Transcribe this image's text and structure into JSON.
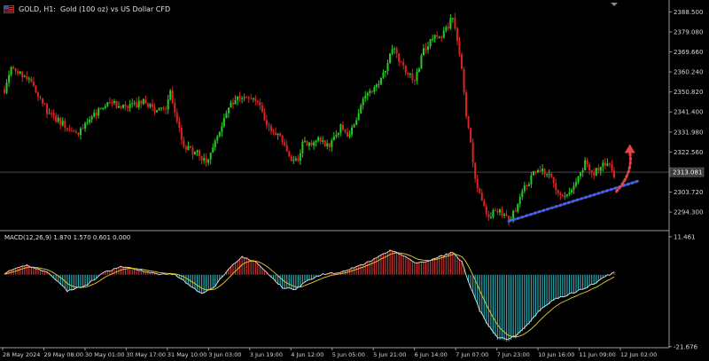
{
  "header": {
    "symbol": "GOLD, H1:",
    "description": "Gold (100 oz) vs US Dollar CFD",
    "flag_icon": "us-flag-icon"
  },
  "colors": {
    "background": "#000000",
    "bull_candle": "#22cc22",
    "bear_candle": "#dd2222",
    "grid_line": "#7a7a7a",
    "current_price_tag": "#3a3a3a",
    "support_line": "#4a5fe8",
    "arrow": "#e44444",
    "macd_positive": "#c83030",
    "macd_negative": "#2aa7b0",
    "macd_line": "#e0e0e0",
    "signal_line": "#e8d22a"
  },
  "chart_data": [
    {
      "type": "candlestick",
      "title": "GOLD, H1: Gold (100 oz) vs US Dollar CFD",
      "xlabel": "",
      "ylabel": "",
      "ylim": [
        2286.0,
        2392.0
      ],
      "y_ticks": [
        "2388.500",
        "2379.080",
        "2369.660",
        "2360.240",
        "2350.820",
        "2341.400",
        "2331.980",
        "2322.560",
        "2313.081",
        "2303.720",
        "2294.300"
      ],
      "current_price": 2313.081,
      "x_ticks": [
        "28 May 2024",
        "29 May 08:00",
        "30 May 01:00",
        "30 May 17:00",
        "31 May 10:00",
        "3 Jun 03:00",
        "3 Jun 19:00",
        "4 Jun 12:00",
        "5 Jun 05:00",
        "5 Jun 21:00",
        "6 Jun 14:00",
        "7 Jun 07:00",
        "7 Jun 23:00",
        "10 Jun 16:00",
        "11 Jun 09:00",
        "12 Jun 02:00"
      ],
      "grid": false,
      "anchors": [
        [
          0,
          2352
        ],
        [
          3,
          2362
        ],
        [
          7,
          2360
        ],
        [
          12,
          2356
        ],
        [
          20,
          2340
        ],
        [
          26,
          2336
        ],
        [
          32,
          2330
        ],
        [
          40,
          2340
        ],
        [
          48,
          2346
        ],
        [
          54,
          2343
        ],
        [
          62,
          2346
        ],
        [
          68,
          2342
        ],
        [
          72,
          2342
        ],
        [
          74,
          2350
        ],
        [
          80,
          2325
        ],
        [
          86,
          2322
        ],
        [
          90,
          2318
        ],
        [
          95,
          2330
        ],
        [
          101,
          2346
        ],
        [
          107,
          2350
        ],
        [
          112,
          2348
        ],
        [
          118,
          2334
        ],
        [
          124,
          2328
        ],
        [
          128,
          2318
        ],
        [
          131,
          2318
        ],
        [
          133,
          2326
        ],
        [
          140,
          2328
        ],
        [
          145,
          2326
        ],
        [
          150,
          2334
        ],
        [
          154,
          2330
        ],
        [
          158,
          2342
        ],
        [
          162,
          2350
        ],
        [
          166,
          2354
        ],
        [
          170,
          2362
        ],
        [
          173,
          2372
        ],
        [
          176,
          2366
        ],
        [
          180,
          2360
        ],
        [
          183,
          2356
        ],
        [
          187,
          2370
        ],
        [
          191,
          2377
        ],
        [
          195,
          2378
        ],
        [
          198,
          2382
        ],
        [
          200,
          2386
        ],
        [
          202,
          2376
        ],
        [
          204,
          2360
        ],
        [
          206,
          2340
        ],
        [
          208,
          2326
        ],
        [
          210,
          2310
        ],
        [
          213,
          2300
        ],
        [
          216,
          2292
        ],
        [
          219,
          2296
        ],
        [
          222,
          2294
        ],
        [
          225,
          2290
        ],
        [
          228,
          2296
        ],
        [
          232,
          2306
        ],
        [
          236,
          2312
        ],
        [
          240,
          2314
        ],
        [
          244,
          2310
        ],
        [
          247,
          2304
        ],
        [
          250,
          2302
        ],
        [
          253,
          2306
        ],
        [
          256,
          2310
        ],
        [
          259,
          2318
        ],
        [
          262,
          2312
        ],
        [
          265,
          2314
        ],
        [
          267,
          2317
        ],
        [
          270,
          2316
        ],
        [
          272,
          2312
        ]
      ]
    },
    {
      "type": "macd",
      "title": "MACD(12,26,9) 1.870 1.570 0.601 0.000",
      "xlabel": "",
      "ylabel": "",
      "ylim": [
        -22.0,
        12.5
      ],
      "y_ticks": [
        "11.461",
        "-21.676"
      ],
      "series": [
        {
          "name": "histogram",
          "kind": "bar"
        },
        {
          "name": "macd",
          "kind": "line"
        },
        {
          "name": "signal",
          "kind": "line"
        }
      ],
      "anchors": [
        [
          0,
          0.5
        ],
        [
          10,
          3.0
        ],
        [
          20,
          0.5
        ],
        [
          28,
          -5.0
        ],
        [
          36,
          -3.5
        ],
        [
          44,
          0.5
        ],
        [
          52,
          2.5
        ],
        [
          60,
          1.5
        ],
        [
          68,
          0.2
        ],
        [
          76,
          0.2
        ],
        [
          82,
          -3.0
        ],
        [
          88,
          -6.0
        ],
        [
          94,
          -3.5
        ],
        [
          100,
          2.0
        ],
        [
          106,
          5.5
        ],
        [
          112,
          4.0
        ],
        [
          118,
          0.0
        ],
        [
          124,
          -4.0
        ],
        [
          130,
          -4.5
        ],
        [
          136,
          -1.5
        ],
        [
          142,
          0.2
        ],
        [
          148,
          0.6
        ],
        [
          154,
          1.8
        ],
        [
          160,
          3.2
        ],
        [
          166,
          5.2
        ],
        [
          172,
          7.5
        ],
        [
          178,
          6.0
        ],
        [
          184,
          3.5
        ],
        [
          190,
          4.5
        ],
        [
          196,
          6.0
        ],
        [
          200,
          7.0
        ],
        [
          204,
          4.0
        ],
        [
          208,
          -4.0
        ],
        [
          212,
          -11.0
        ],
        [
          216,
          -16.0
        ],
        [
          220,
          -19.5
        ],
        [
          224,
          -20.0
        ],
        [
          228,
          -19.0
        ],
        [
          234,
          -15.0
        ],
        [
          240,
          -10.0
        ],
        [
          246,
          -7.5
        ],
        [
          252,
          -6.0
        ],
        [
          258,
          -4.5
        ],
        [
          264,
          -2.5
        ],
        [
          268,
          -0.5
        ],
        [
          272,
          0.6
        ]
      ]
    }
  ],
  "annotations": {
    "support_line": {
      "type": "dotted-trendline",
      "from": [
        225,
        2290
      ],
      "to": [
        283,
        2309
      ]
    },
    "projection_arrow": {
      "type": "dotted-arrow-up",
      "from": [
        273,
        2304
      ],
      "to": [
        279,
        2325
      ]
    }
  }
}
